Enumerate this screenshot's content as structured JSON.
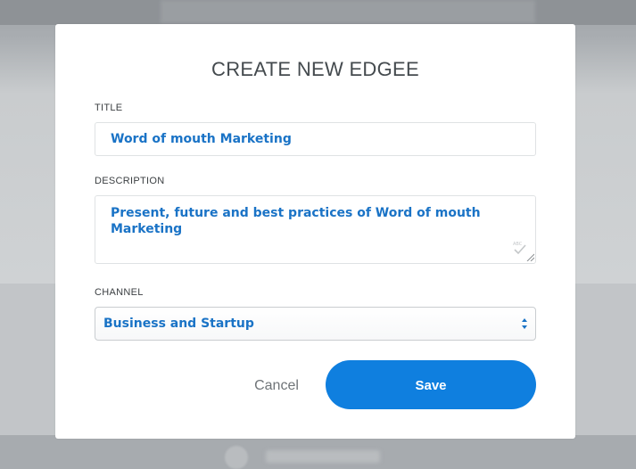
{
  "modal": {
    "title": "CREATE NEW EDGEE",
    "fields": {
      "title": {
        "label": "TITLE",
        "value": "Word of mouth Marketing"
      },
      "description": {
        "label": "DESCRIPTION",
        "value": "Present, future and best practices of Word of mouth Marketing"
      },
      "channel": {
        "label": "CHANNEL",
        "selected": "Business and Startup"
      }
    },
    "actions": {
      "cancel_label": "Cancel",
      "save_label": "Save"
    }
  },
  "icons": {
    "spellcheck": "spellcheck-icon",
    "resize": "resize-grip-icon",
    "select_arrows": "updown-arrows-icon"
  },
  "colors": {
    "accent": "#0f7fdf",
    "input_text": "#1a73c6",
    "title_text": "#444a4e",
    "overlay_bg": "#b9bcbf"
  }
}
